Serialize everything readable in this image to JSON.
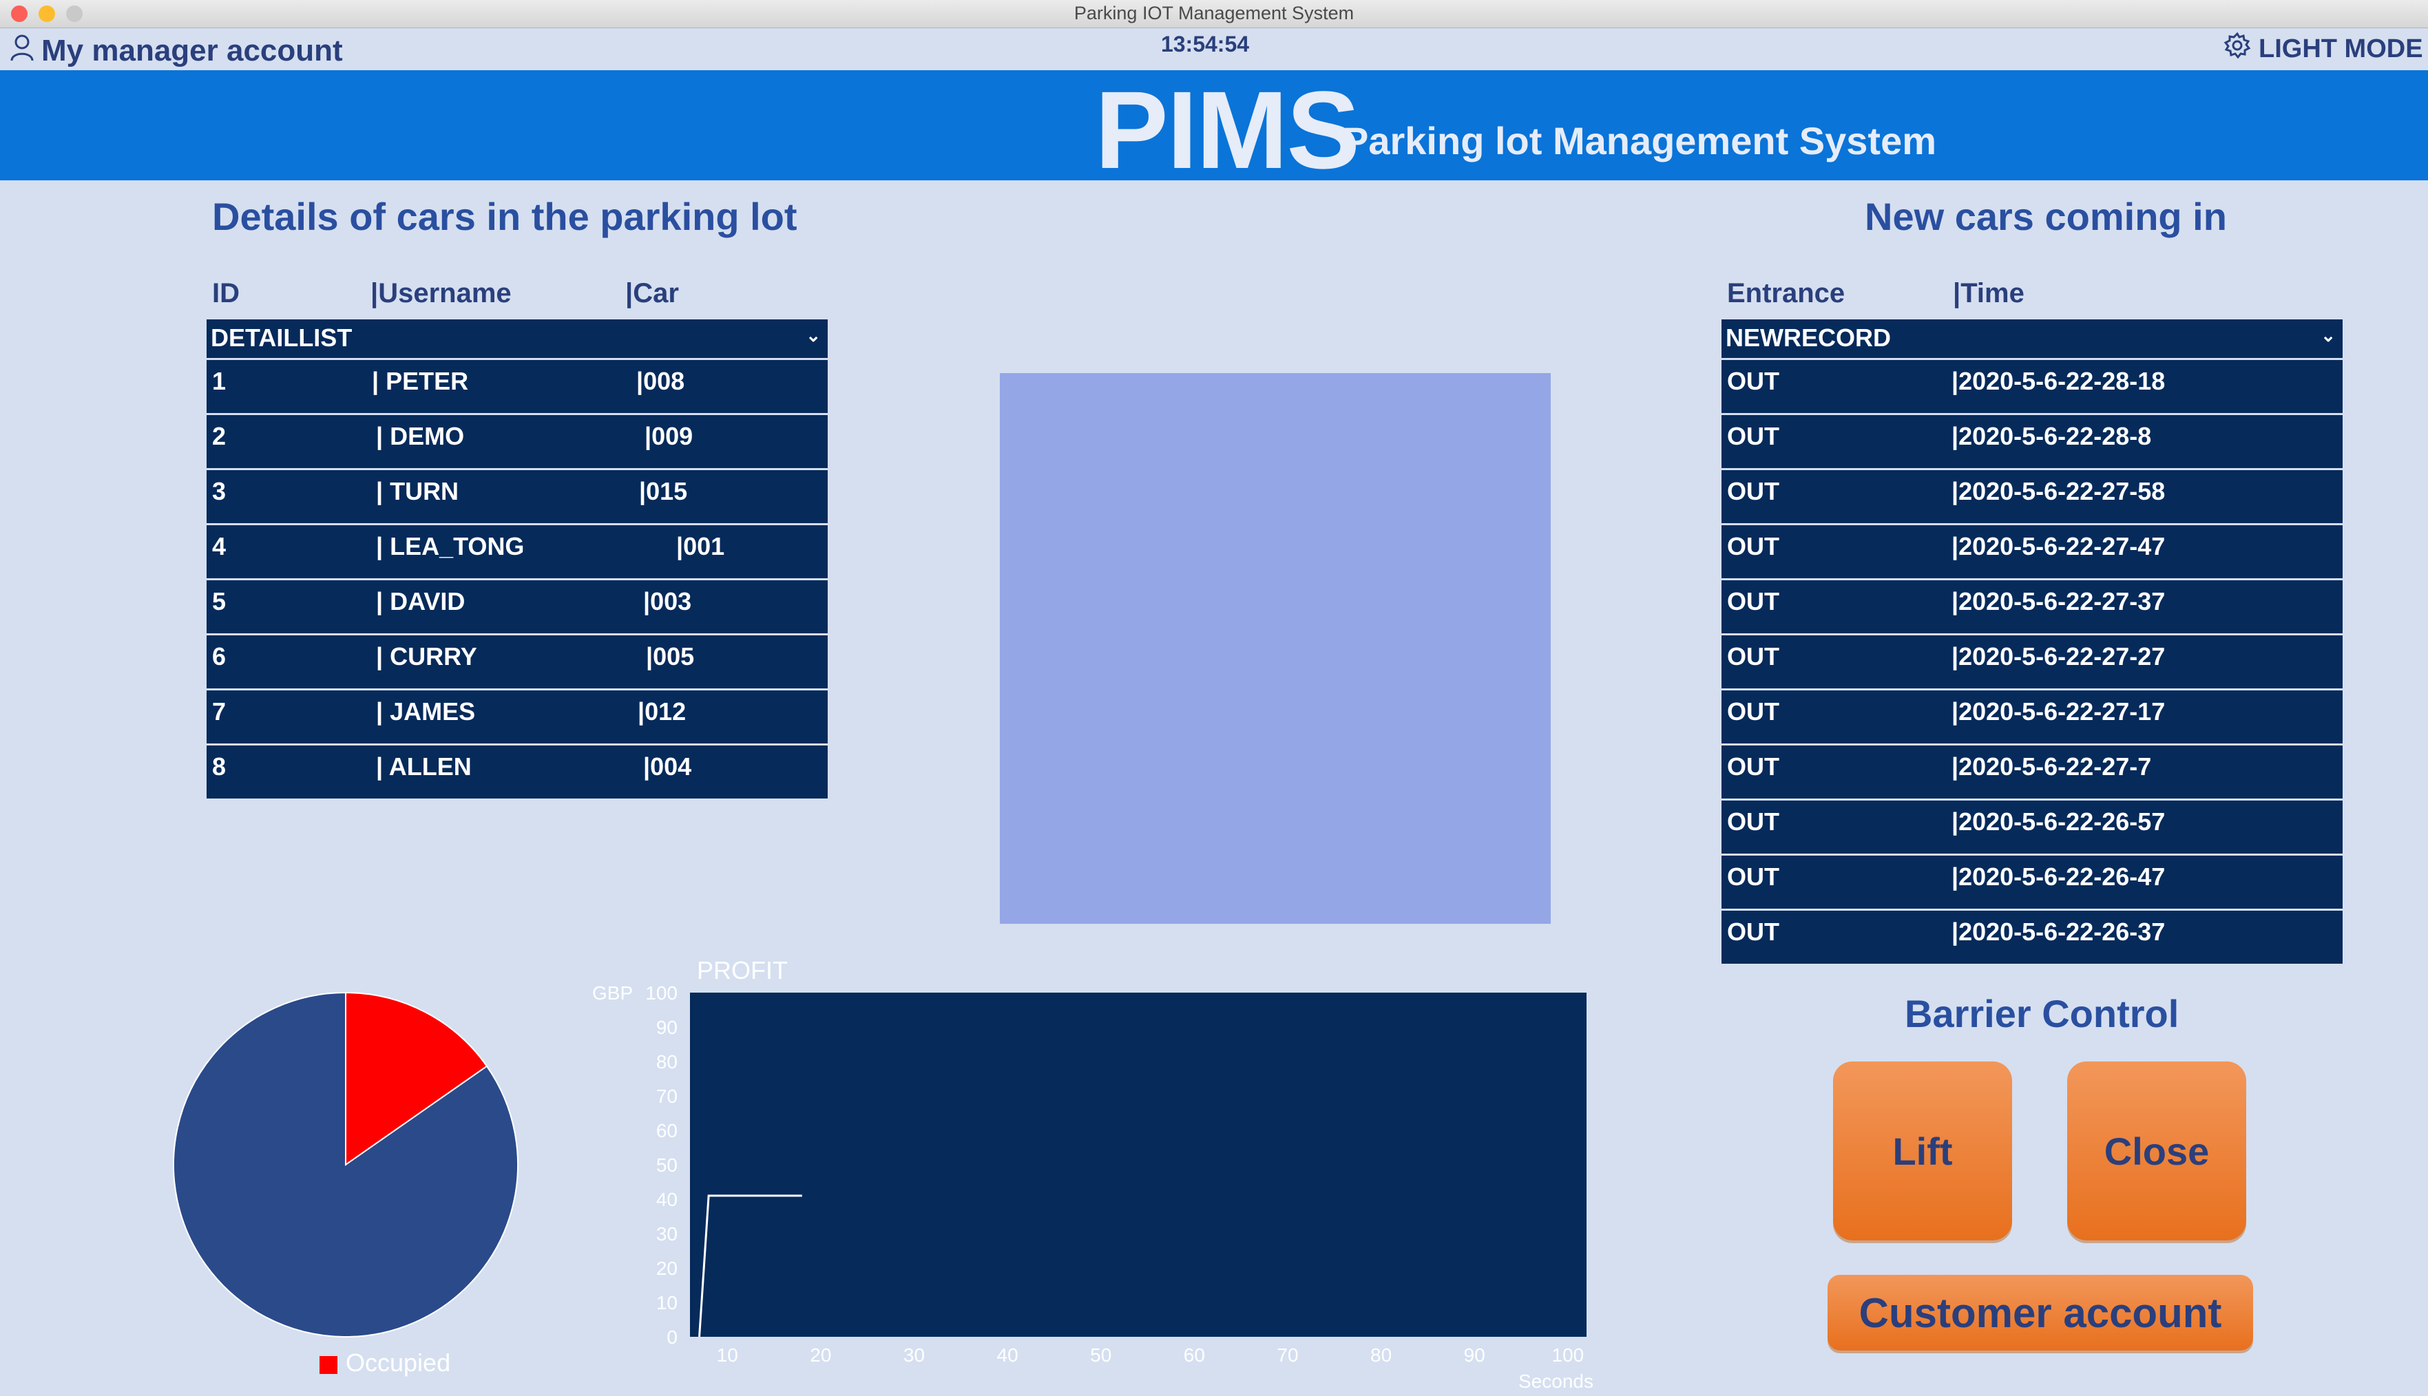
{
  "window": {
    "title": "Parking IOT Management System"
  },
  "topbar": {
    "account_label": "My manager account",
    "clock": "13:54:54",
    "mode_label": "LIGHT MODE"
  },
  "header": {
    "logo": "PIMS",
    "subtitle": "Parking lot Management System"
  },
  "details": {
    "title": "Details of cars in the parking lot",
    "columns": [
      "ID",
      "|Username",
      "|Car"
    ],
    "list_label": "DETAILLIST",
    "rows": [
      {
        "id": "1",
        "user": "| PETER",
        "car": "|008"
      },
      {
        "id": "2",
        "user": "| DEMO",
        "car": "|009"
      },
      {
        "id": "3",
        "user": "| TURN",
        "car": "|015"
      },
      {
        "id": "4",
        "user": "| LEA_TONG",
        "car": "|001"
      },
      {
        "id": "5",
        "user": "| DAVID",
        "car": "|003"
      },
      {
        "id": "6",
        "user": "| CURRY",
        "car": "|005"
      },
      {
        "id": "7",
        "user": "| JAMES",
        "car": "|012"
      },
      {
        "id": "8",
        "user": "| ALLEN",
        "car": "|004"
      }
    ]
  },
  "newcars": {
    "title": "New cars coming in",
    "columns": [
      "Entrance",
      "|Time"
    ],
    "list_label": "NEWRECORD",
    "rows": [
      {
        "entrance": "OUT",
        "time": "|2020-5-6-22-28-18"
      },
      {
        "entrance": "OUT",
        "time": "|2020-5-6-22-28-8"
      },
      {
        "entrance": "OUT",
        "time": "|2020-5-6-22-27-58"
      },
      {
        "entrance": "OUT",
        "time": "|2020-5-6-22-27-47"
      },
      {
        "entrance": "OUT",
        "time": "|2020-5-6-22-27-37"
      },
      {
        "entrance": "OUT",
        "time": "|2020-5-6-22-27-27"
      },
      {
        "entrance": "OUT",
        "time": "|2020-5-6-22-27-17"
      },
      {
        "entrance": "OUT",
        "time": "|2020-5-6-22-27-7"
      },
      {
        "entrance": "OUT",
        "time": "|2020-5-6-22-26-57"
      },
      {
        "entrance": "OUT",
        "time": "|2020-5-6-22-26-47"
      },
      {
        "entrance": "OUT",
        "time": "|2020-5-6-22-26-37"
      }
    ]
  },
  "barrier": {
    "title": "Barrier Control",
    "lift_label": "Lift",
    "close_label": "Close",
    "customer_label": "Customer account"
  },
  "colors": {
    "accent": "#0a74d8",
    "navy": "#062a5a",
    "occupied": "#ff0000",
    "free": "#2a4a8a",
    "button": "#ec7f35",
    "background": "#d5dff0"
  },
  "icons": {
    "account": "user-icon",
    "mode": "gear-icon"
  },
  "chart_data": [
    {
      "type": "pie",
      "slices": [
        {
          "name": "Occupied",
          "value": 0.153,
          "color": "#ff0000"
        },
        {
          "name": "",
          "value": 0.847,
          "color": "#2a4a8a"
        }
      ],
      "legend": [
        "Occupied"
      ],
      "legend_position": "bottom"
    },
    {
      "type": "line",
      "title": "PROFIT",
      "xlabel": "Seconds",
      "ylabel": "GBP",
      "xlim": [
        6,
        102
      ],
      "ylim": [
        0,
        100
      ],
      "xticks": [
        10,
        20,
        30,
        40,
        50,
        60,
        70,
        80,
        90,
        100
      ],
      "yticks": [
        0,
        10,
        20,
        30,
        40,
        50,
        60,
        70,
        80,
        90,
        100
      ],
      "x": [
        7,
        8,
        18
      ],
      "y": [
        0,
        41,
        41
      ],
      "line_color": "#ffffff"
    }
  ]
}
